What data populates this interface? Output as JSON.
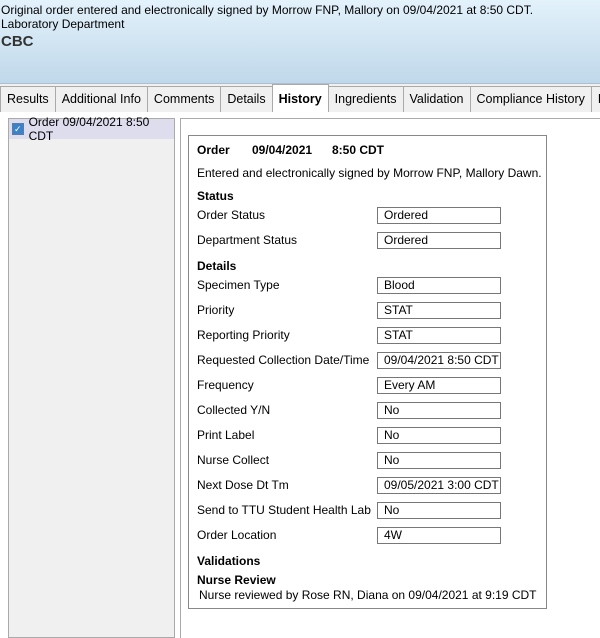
{
  "header": {
    "line1": "Original order entered and electronically signed by Morrow FNP, Mallory on 09/04/2021 at 8:50 CDT.",
    "line2": "Laboratory Department",
    "title": "CBC"
  },
  "tabs": [
    "Results",
    "Additional Info",
    "Comments",
    "Details",
    "History",
    "Ingredients",
    "Validation",
    "Compliance History",
    "P"
  ],
  "active_tab": "History",
  "history_list": [
    {
      "label": "Order 09/04/2021 8:50 CDT",
      "checked": true
    }
  ],
  "order": {
    "type": "Order",
    "date": "09/04/2021",
    "time": "8:50 CDT",
    "signed": "Entered and electronically signed by Morrow FNP, Mallory Dawn."
  },
  "status_heading": "Status",
  "status_fields": [
    {
      "label": "Order Status",
      "value": "Ordered"
    },
    {
      "label": "Department Status",
      "value": "Ordered"
    }
  ],
  "details_heading": "Details",
  "detail_fields": [
    {
      "label": "Specimen Type",
      "value": "Blood"
    },
    {
      "label": "Priority",
      "value": "STAT"
    },
    {
      "label": "Reporting Priority",
      "value": "STAT"
    },
    {
      "label": "Requested Collection Date/Time",
      "value": "09/04/2021 8:50 CDT"
    },
    {
      "label": "Frequency",
      "value": "Every AM"
    },
    {
      "label": "Collected Y/N",
      "value": "No"
    },
    {
      "label": "Print Label",
      "value": "No"
    },
    {
      "label": "Nurse Collect",
      "value": "No"
    },
    {
      "label": "Next Dose Dt Tm",
      "value": "09/05/2021 3:00 CDT"
    },
    {
      "label": "Send to TTU Student Health Lab",
      "value": "No"
    },
    {
      "label": "Order Location",
      "value": "4W"
    }
  ],
  "validations": {
    "heading": "Validations",
    "sub": "Nurse Review",
    "text": "Nurse reviewed by Rose RN, Diana on 09/04/2021 at 9:19 CDT"
  }
}
